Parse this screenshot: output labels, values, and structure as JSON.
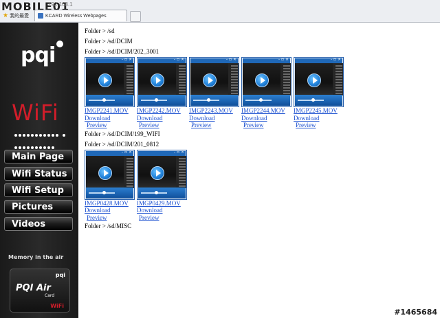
{
  "browser": {
    "watermark_top": "MOBILE01",
    "address_hint": "192.168.1",
    "favorites_label": "我的最愛",
    "tab_title": "KCARD Wireless Webpages"
  },
  "sidebar": {
    "logo": "pqi",
    "wifi": "WiFi",
    "nav": [
      {
        "label": "Main Page"
      },
      {
        "label": "Wifi Status"
      },
      {
        "label": "Wifi Setup"
      },
      {
        "label": "Pictures"
      },
      {
        "label": "Videos"
      }
    ],
    "tagline": "Memory in the air",
    "card": {
      "brand": "pqi",
      "name": "PQI Air",
      "sub": "Card",
      "wifi": "WiFi"
    }
  },
  "main": {
    "sections": [
      {
        "folder": "Folder > /sd",
        "files": []
      },
      {
        "folder": "Folder > /sd/DCIM",
        "files": []
      },
      {
        "folder": "Folder > /sd/DCIM/202_3001",
        "files": [
          {
            "name": "IMGP2241.MOV",
            "download": "Download",
            "preview": "Preview"
          },
          {
            "name": "IMGP2242.MOV",
            "download": "Download",
            "preview": "Preview"
          },
          {
            "name": "IMGP2243.MOV",
            "download": "Download",
            "preview": "Preview"
          },
          {
            "name": "IMGP2244.MOV",
            "download": "Download",
            "preview": "Preview"
          },
          {
            "name": "IMGP2245.MOV",
            "download": "Download",
            "preview": "Preview"
          }
        ]
      },
      {
        "folder": "Folder > /sd/DCIM/199_WIFI",
        "files": []
      },
      {
        "folder": "Folder > /sd/DCIM/201_0812",
        "files": [
          {
            "name": "IMGP0428.MOV",
            "download": "Download",
            "preview": "Preview"
          },
          {
            "name": "IMGP0429.MOV",
            "download": "Download",
            "preview": "Preview"
          }
        ]
      },
      {
        "folder": "Folder > /sd/MISC",
        "files": []
      }
    ]
  },
  "watermark_bottom": "#1465684",
  "colors": {
    "brand_red": "#d21d2a",
    "link": "#1a4fd0",
    "thumb_blue": "#1f68b8"
  },
  "icons": {
    "play": "play-icon",
    "favorites": "star-icon"
  }
}
